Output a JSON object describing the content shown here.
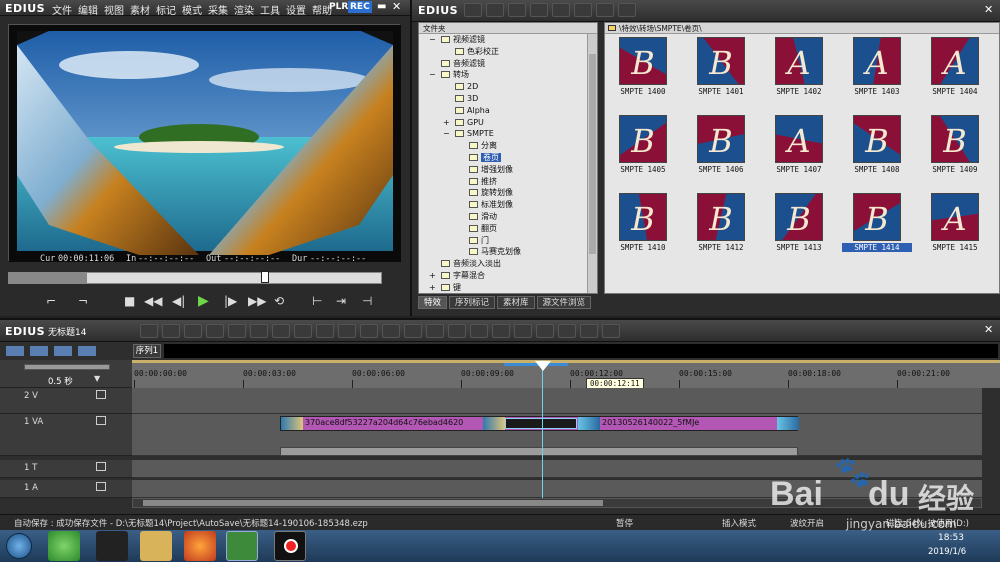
{
  "player": {
    "logo": "EDIUS",
    "menu": [
      "文件",
      "编辑",
      "视图",
      "素材",
      "标记",
      "模式",
      "采集",
      "渲染",
      "工具",
      "设置",
      "帮助"
    ],
    "plr": "PLR",
    "rec": "REC",
    "cur_label": "Cur",
    "cur_value": "00:00:11:06",
    "in_label": "In",
    "in_value": "--:--:--:--",
    "out_label": "Out",
    "out_value": "--:--:--:--",
    "dur_label": "Dur",
    "dur_value": "--:--:--:--"
  },
  "bin": {
    "logo": "EDIUS",
    "tree_header": "文件夹",
    "path": "\\特效\\转场\\SMPTE\\卷页\\",
    "tree": [
      {
        "label": "视频滤镜",
        "level": 1,
        "toggle": "−"
      },
      {
        "label": "色彩校正",
        "level": 2,
        "toggle": ""
      },
      {
        "label": "音频滤镜",
        "level": 1,
        "toggle": ""
      },
      {
        "label": "转场",
        "level": 1,
        "toggle": "−"
      },
      {
        "label": "2D",
        "level": 2,
        "toggle": ""
      },
      {
        "label": "3D",
        "level": 2,
        "toggle": ""
      },
      {
        "label": "Alpha",
        "level": 2,
        "toggle": ""
      },
      {
        "label": "GPU",
        "level": 2,
        "toggle": "+"
      },
      {
        "label": "SMPTE",
        "level": 2,
        "toggle": "−"
      },
      {
        "label": "分离",
        "level": 3,
        "toggle": ""
      },
      {
        "label": "卷页",
        "level": 3,
        "toggle": "",
        "selected": true
      },
      {
        "label": "增强划像",
        "level": 3,
        "toggle": ""
      },
      {
        "label": "推挤",
        "level": 3,
        "toggle": ""
      },
      {
        "label": "旋转划像",
        "level": 3,
        "toggle": ""
      },
      {
        "label": "标准划像",
        "level": 3,
        "toggle": ""
      },
      {
        "label": "滑动",
        "level": 3,
        "toggle": ""
      },
      {
        "label": "翻页",
        "level": 3,
        "toggle": ""
      },
      {
        "label": "门",
        "level": 3,
        "toggle": ""
      },
      {
        "label": "马赛克划像",
        "level": 3,
        "toggle": ""
      },
      {
        "label": "音频淡入淡出",
        "level": 1,
        "toggle": ""
      },
      {
        "label": "字幕混合",
        "level": 1,
        "toggle": "+"
      },
      {
        "label": "键",
        "level": 1,
        "toggle": "+"
      }
    ],
    "thumbnails": [
      {
        "label": "SMPTE 1400",
        "letter": "B"
      },
      {
        "label": "SMPTE 1401",
        "letter": "B"
      },
      {
        "label": "SMPTE 1402",
        "letter": "A"
      },
      {
        "label": "SMPTE 1403",
        "letter": "A"
      },
      {
        "label": "SMPTE 1404",
        "letter": "A"
      },
      {
        "label": "SMPTE 1405",
        "letter": "B"
      },
      {
        "label": "SMPTE 1406",
        "letter": "B"
      },
      {
        "label": "SMPTE 1407",
        "letter": "A"
      },
      {
        "label": "SMPTE 1408",
        "letter": "B"
      },
      {
        "label": "SMPTE 1409",
        "letter": "B"
      },
      {
        "label": "SMPTE 1410",
        "letter": "B"
      },
      {
        "label": "SMPTE 1412",
        "letter": "B"
      },
      {
        "label": "SMPTE 1413",
        "letter": "B"
      },
      {
        "label": "SMPTE 1414",
        "letter": "B",
        "selected": true
      },
      {
        "label": "SMPTE 1415",
        "letter": "A"
      }
    ],
    "tabs": [
      "特效",
      "序列标记",
      "素材库",
      "源文件浏览"
    ]
  },
  "timeline": {
    "logo": "EDIUS",
    "project": "无标题14",
    "sequence_tab": "序列1",
    "zoom": "0.5 秒",
    "ruler_ticks": [
      "00:00:00:00",
      "00:00:03:00",
      "00:00:06:00",
      "00:00:09:00",
      "00:00:12:00",
      "00:00:15:00",
      "00:00:18:00",
      "00:00:21:00"
    ],
    "tooltip": "00:00:12:11",
    "tracks": [
      {
        "name": "2 V"
      },
      {
        "name": "1 VA"
      },
      {
        "name": "1 T"
      },
      {
        "name": "1 A"
      }
    ],
    "clip1": "370ace8df53227a204d64c76ebad4620",
    "clip2": "20130526140022_5fMJe"
  },
  "status": {
    "autosave": "自动保存 : 成功保存文件 - D:\\无标题14\\Project\\AutoSave\\无标题14-190106-185348.ezp",
    "pause": "暂停",
    "insert": "插入模式",
    "ripple": "波纹开启",
    "disk": "磁盘:54% 被使用(D:)"
  },
  "taskbar": {
    "time": "18:53",
    "date": "2019/1/6"
  },
  "watermark": {
    "text1": "Bai",
    "text2": "du",
    "text3": "经验",
    "url": "jingyan.baidu.com"
  }
}
